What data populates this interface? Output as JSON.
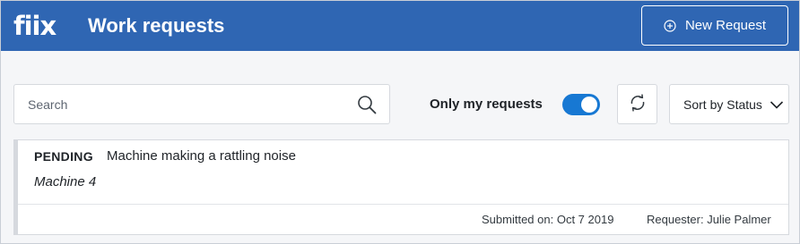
{
  "header": {
    "logo": "fiix",
    "title": "Work requests",
    "new_request_label": "New Request"
  },
  "toolbar": {
    "search_placeholder": "Search",
    "search_value": "",
    "only_my_requests_label": "Only my requests",
    "only_my_requests_on": true,
    "sort_label": "Sort by Status"
  },
  "requests": [
    {
      "status": "PENDING",
      "title": "Machine making a rattling noise",
      "asset": "Machine 4",
      "submitted": "Submitted on: Oct 7 2019",
      "requester": "Requester: Julie Palmer"
    }
  ],
  "colors": {
    "header_bg": "#2f66b3",
    "toggle_on": "#1778d3"
  }
}
